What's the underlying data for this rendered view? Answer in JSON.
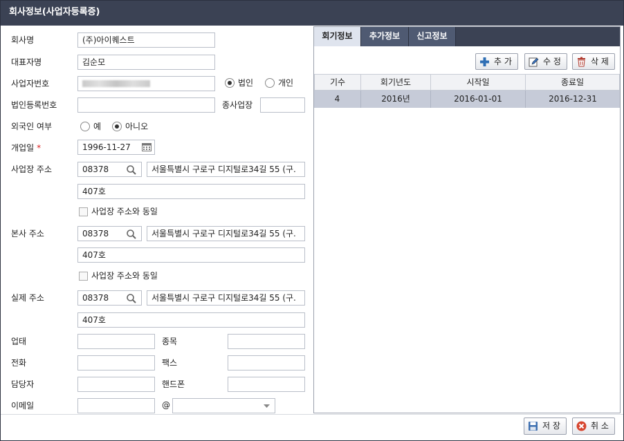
{
  "window": {
    "title": "회사정보(사업자등록증)"
  },
  "form": {
    "company_name": {
      "label": "회사명",
      "value": "(주)아이퀘스트"
    },
    "ceo_name": {
      "label": "대표자명",
      "value": "김순모"
    },
    "business_number": {
      "label": "사업자번호",
      "value": "",
      "corp_label": "법인",
      "individual_label": "개인"
    },
    "corp_reg_number": {
      "label": "법인등록번호",
      "value": ""
    },
    "branch": {
      "label": "종사업장",
      "value": ""
    },
    "foreigner": {
      "label": "외국인 여부",
      "yes_label": "예",
      "no_label": "아니오"
    },
    "opening_date": {
      "label": "개업일",
      "required": "*",
      "value": "1996-11-27"
    },
    "business_address": {
      "label": "사업장 주소",
      "zip": "08378",
      "address": "서울특별시 구로구 디지털로34길 55 (구.",
      "detail": "407호"
    },
    "head_address": {
      "label": "본사 주소",
      "same_label": "사업장 주소와 동일",
      "zip": "08378",
      "address": "서울특별시 구로구 디지털로34길 55 (구.",
      "detail": "407호"
    },
    "actual_address": {
      "label": "실제 주소",
      "same_label": "사업장 주소와 동일",
      "zip": "08378",
      "address": "서울특별시 구로구 디지털로34길 55 (구.",
      "detail": "407호"
    },
    "business_type": {
      "label": "업태",
      "value": ""
    },
    "business_item": {
      "label": "종목",
      "value": ""
    },
    "phone": {
      "label": "전화",
      "value": ""
    },
    "fax": {
      "label": "팩스",
      "value": ""
    },
    "manager": {
      "label": "담당자",
      "value": ""
    },
    "mobile": {
      "label": "핸드폰",
      "value": ""
    },
    "email": {
      "label": "이메일",
      "value": "",
      "at": "@",
      "domain": ""
    }
  },
  "tabs": [
    {
      "label": "회기정보"
    },
    {
      "label": "추가정보"
    },
    {
      "label": "신고정보"
    }
  ],
  "toolbar": {
    "add": "추 가",
    "edit": "수 정",
    "delete": "삭 제"
  },
  "grid": {
    "columns": [
      "기수",
      "회기년도",
      "시작일",
      "종료일"
    ],
    "rows": [
      [
        "4",
        "2016년",
        "2016-01-01",
        "2016-12-31"
      ]
    ]
  },
  "footer": {
    "save": "저 장",
    "cancel": "취 소"
  },
  "colors": {
    "titlebar": "#3b4254",
    "selected_row": "#c6cbd8",
    "required": "#dd2222"
  }
}
